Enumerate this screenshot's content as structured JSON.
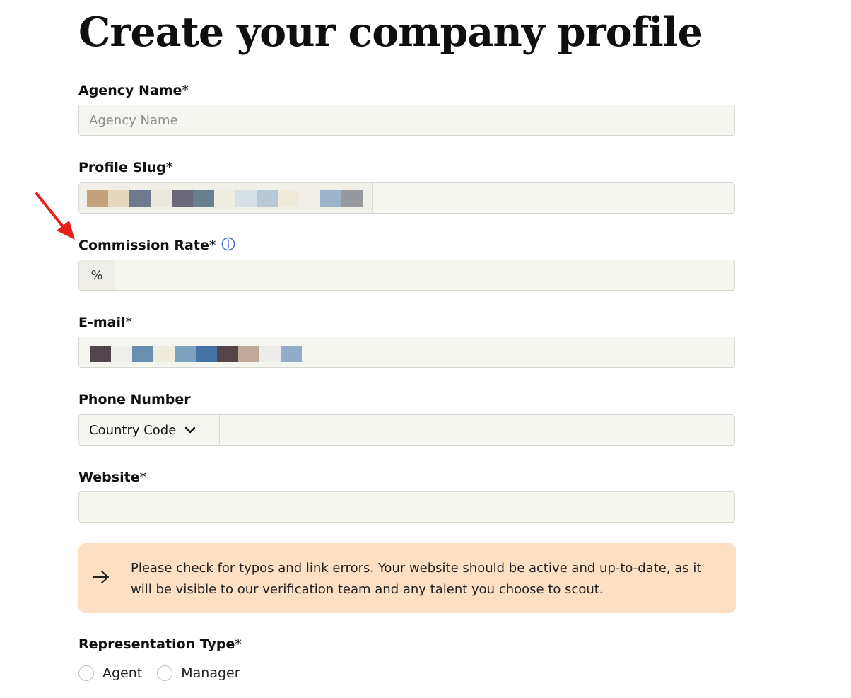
{
  "page": {
    "title": "Create your company profile"
  },
  "form": {
    "agency_name": {
      "label": "Agency Name",
      "required_mark": "*",
      "placeholder": "Agency Name",
      "value": ""
    },
    "profile_slug": {
      "label": "Profile Slug",
      "required_mark": "*",
      "value": ""
    },
    "commission_rate": {
      "label": "Commission Rate",
      "required_mark": "*",
      "prefix": "%",
      "value": ""
    },
    "email": {
      "label": "E-mail",
      "required_mark": "*"
    },
    "phone": {
      "label": "Phone Number",
      "country_code_label": "Country Code",
      "value": ""
    },
    "website": {
      "label": "Website",
      "required_mark": "*",
      "value": ""
    },
    "notice": {
      "text": "Please check for typos and link errors. Your website should be active and up-to-date, as it will be visible to our verification team and any talent you choose to scout."
    },
    "representation_type": {
      "label": "Representation Type",
      "required_mark": "*",
      "options": [
        {
          "label": "Agent",
          "selected": false
        },
        {
          "label": "Manager",
          "selected": false
        }
      ]
    }
  },
  "icons": {
    "info": "info-icon",
    "chevron": "chevron-down-icon",
    "notice_arrow": "arrow-right-icon",
    "annotation": "red-pointer-arrow"
  },
  "redacted": {
    "slug_mask_colors": [
      "#c4a27e",
      "#e6d8bf",
      "#6d7a8d",
      "#ede9de",
      "#6b6878",
      "#687f91",
      "#efede2",
      "#d7e1e5",
      "#b7c8d6",
      "#efeadc",
      "#f0efe8",
      "#9db3c9",
      "#969a9e"
    ],
    "email_mask_colors": [
      "#4f454b",
      "#eeeeec",
      "#6a8ead",
      "#f0ebdf",
      "#7ea2bd",
      "#4473a4",
      "#524449",
      "#c0a89a",
      "#ececea",
      "#93acc7"
    ]
  },
  "colors": {
    "field_bg": "#f6f6f1",
    "field_border": "#d8d8d3",
    "notice_bg": "#fddfc4",
    "info_icon": "#4a6fd1",
    "annotation_arrow": "#e8201c"
  }
}
